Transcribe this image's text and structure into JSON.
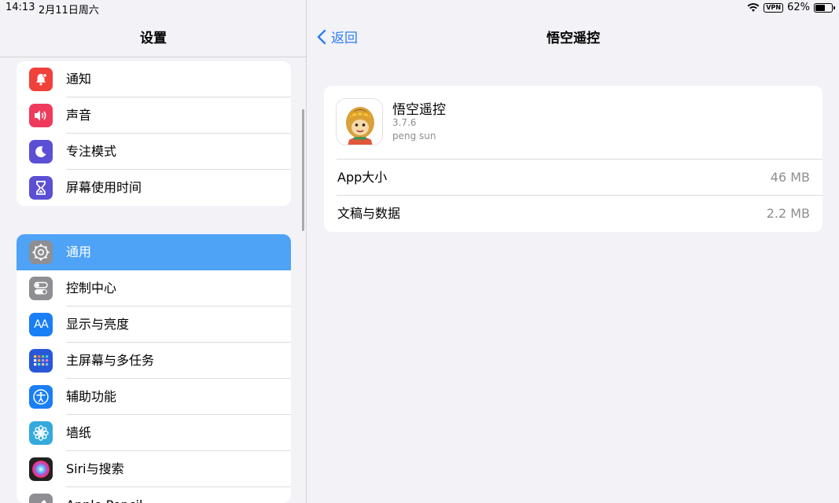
{
  "status": {
    "time": "14:13",
    "date": "2月11日周六",
    "vpn": "VPN",
    "battery": "62%",
    "battery_level": 0.62
  },
  "sidebar": {
    "title": "设置",
    "groups": [
      {
        "items": [
          {
            "label": "通知",
            "icon": "bell-icon",
            "color": "#f0413b"
          },
          {
            "label": "声音",
            "icon": "speaker-icon",
            "color": "#f03a5c"
          },
          {
            "label": "专注模式",
            "icon": "moon-icon",
            "color": "#5b4fd3"
          },
          {
            "label": "屏幕使用时间",
            "icon": "hourglass-icon",
            "color": "#5b4fd3"
          }
        ]
      },
      {
        "items": [
          {
            "label": "通用",
            "icon": "gear-icon",
            "color": "#8e8e93",
            "selected": true
          },
          {
            "label": "控制中心",
            "icon": "toggles-icon",
            "color": "#8e8e93"
          },
          {
            "label": "显示与亮度",
            "icon": "text-size-icon",
            "color": "#1a7ef5",
            "glyph": "AA"
          },
          {
            "label": "主屏幕与多任务",
            "icon": "app-grid-icon",
            "color": "#2857d8"
          },
          {
            "label": "辅助功能",
            "icon": "accessibility-icon",
            "color": "#1a7ef5"
          },
          {
            "label": "墙纸",
            "icon": "flower-icon",
            "color": "#34aadc"
          },
          {
            "label": "Siri与搜索",
            "icon": "siri-icon",
            "color": "#222"
          },
          {
            "label": "Apple Pencil",
            "icon": "pencil-icon",
            "color": "#8e8e93"
          }
        ]
      }
    ]
  },
  "detail": {
    "back_label": "返回",
    "title": "悟空遥控",
    "app": {
      "name": "悟空遥控",
      "version": "3.7.6",
      "developer": "peng sun",
      "icon": "monkey-king-app-icon"
    },
    "rows": [
      {
        "key": "App大小",
        "value": "46 MB"
      },
      {
        "key": "文稿与数据",
        "value": "2.2 MB"
      }
    ]
  }
}
